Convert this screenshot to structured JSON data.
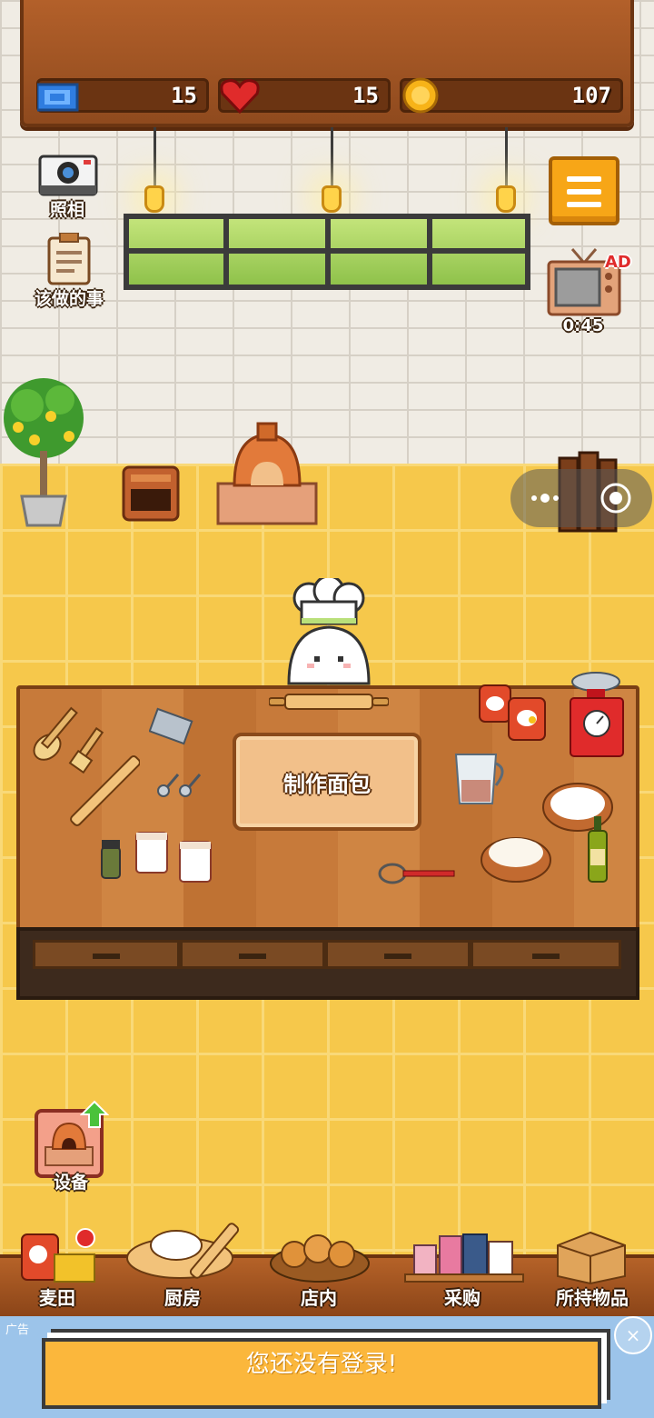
{
  "stats": {
    "tickets": "15",
    "hearts": "15",
    "coins": "107"
  },
  "left_menu": {
    "camera_label": "照相",
    "todo_label": "该做的事"
  },
  "ad_tv": {
    "badge": "AD",
    "timer": "0:45"
  },
  "table": {
    "make_bread_label": "制作面包"
  },
  "equipment": {
    "label": "设备"
  },
  "bottom_nav": {
    "items": [
      {
        "label": "麦田"
      },
      {
        "label": "厨房"
      },
      {
        "label": "店内"
      },
      {
        "label": "采购"
      },
      {
        "label": "所持物品"
      }
    ]
  },
  "ad_banner": {
    "tag": "广告",
    "message": "您还没有登录!",
    "close": "×"
  },
  "colors": {
    "wood": "#b3602a",
    "floor": "#f6c84b",
    "accent": "#f7a617",
    "ad_bg": "#fbb73c"
  }
}
